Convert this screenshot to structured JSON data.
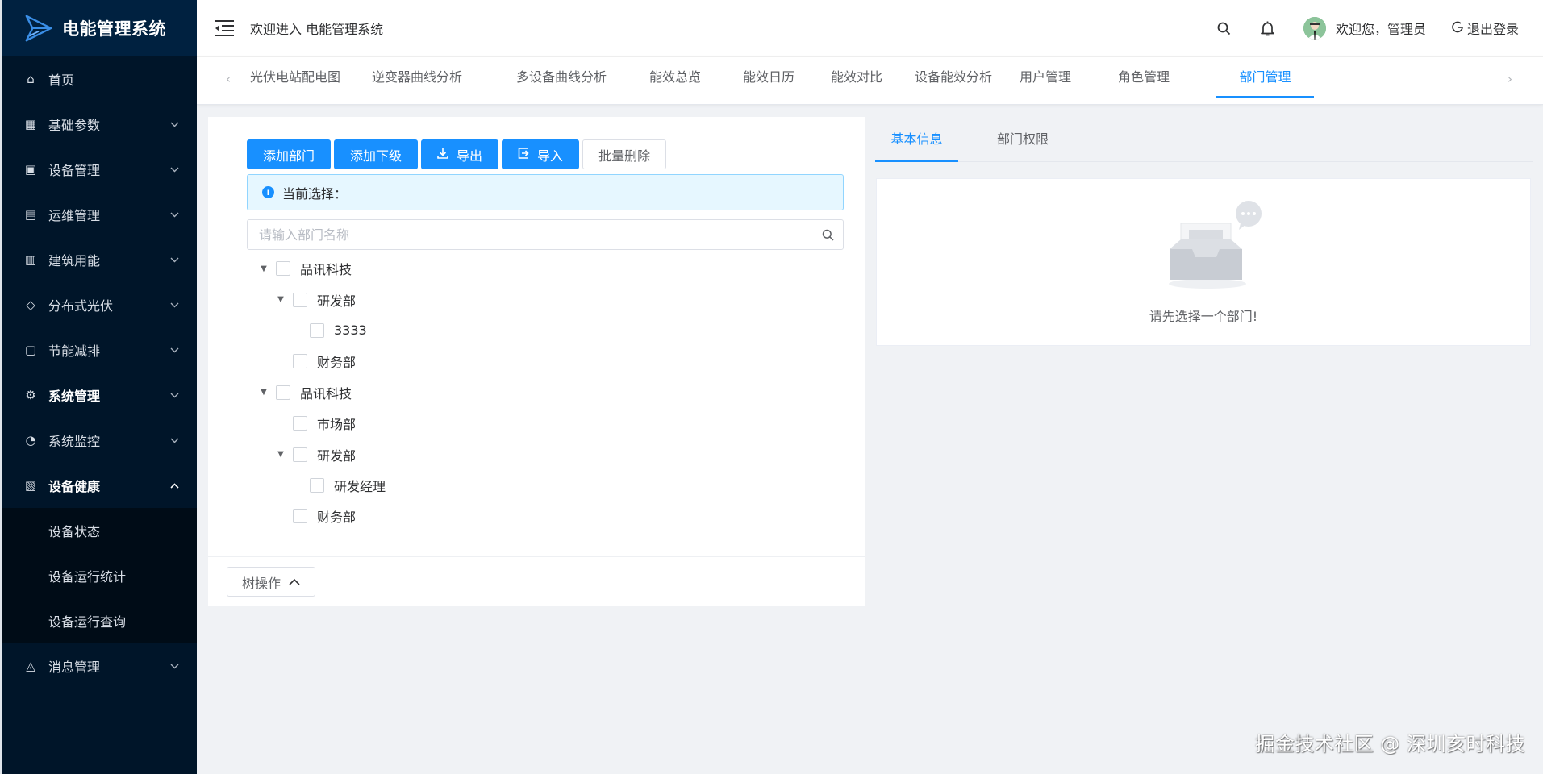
{
  "app": {
    "title": "电能管理系统"
  },
  "sidebar": {
    "items": [
      {
        "label": "首页",
        "icon": "home-icon",
        "expandable": false
      },
      {
        "label": "基础参数",
        "icon": "grid-icon",
        "expandable": true
      },
      {
        "label": "设备管理",
        "icon": "device-icon",
        "expandable": true
      },
      {
        "label": "运维管理",
        "icon": "doc-icon",
        "expandable": true
      },
      {
        "label": "建筑用能",
        "icon": "building-icon",
        "expandable": true
      },
      {
        "label": "分布式光伏",
        "icon": "solar-icon",
        "expandable": true
      },
      {
        "label": "节能减排",
        "icon": "leaf-icon",
        "expandable": true
      },
      {
        "label": "系统管理",
        "icon": "gear-icon",
        "expandable": true
      },
      {
        "label": "系统监控",
        "icon": "monitor-icon",
        "expandable": true
      },
      {
        "label": "设备健康",
        "icon": "health-icon",
        "expandable": true,
        "expanded": true,
        "children": [
          "设备状态",
          "设备运行统计",
          "设备运行查询"
        ]
      },
      {
        "label": "消息管理",
        "icon": "bell-icon",
        "expandable": true
      }
    ]
  },
  "header": {
    "welcome": "欢迎进入 电能管理系统",
    "user_greeting": "欢迎您，管理员",
    "logout": "退出登录"
  },
  "tabs": [
    "光伏电站配电图",
    "逆变器曲线分析",
    "多设备曲线分析",
    "能效总览",
    "能效日历",
    "能效对比",
    "设备能效分析",
    "用户管理",
    "角色管理",
    "部门管理"
  ],
  "active_tab": "部门管理",
  "toolbar": {
    "add_dept": "添加部门",
    "add_child": "添加下级",
    "export": "导出",
    "import": "导入",
    "batch_delete": "批量删除"
  },
  "alert": {
    "text": "当前选择："
  },
  "search": {
    "placeholder": "请输入部门名称"
  },
  "tree": [
    {
      "label": "品讯科技",
      "level": 0,
      "expanded": true
    },
    {
      "label": "研发部",
      "level": 1,
      "expanded": true
    },
    {
      "label": "3333",
      "level": 2,
      "leaf": true
    },
    {
      "label": "财务部",
      "level": 1,
      "leaf": true
    },
    {
      "label": "品讯科技",
      "level": 0,
      "expanded": true
    },
    {
      "label": "市场部",
      "level": 1,
      "leaf": true
    },
    {
      "label": "研发部",
      "level": 1,
      "expanded": true
    },
    {
      "label": "研发经理",
      "level": 2,
      "leaf": true
    },
    {
      "label": "财务部",
      "level": 1,
      "leaf": true
    }
  ],
  "tree_op": {
    "label": "树操作"
  },
  "right": {
    "tabs": [
      "基本信息",
      "部门权限"
    ],
    "active_tab": "基本信息",
    "empty_text": "请先选择一个部门!"
  },
  "watermark": "掘金技术社区 @ 深圳亥时科技",
  "colors": {
    "primary": "#1890ff",
    "sidebar_bg": "#001529",
    "submenu_bg": "#000c17"
  }
}
